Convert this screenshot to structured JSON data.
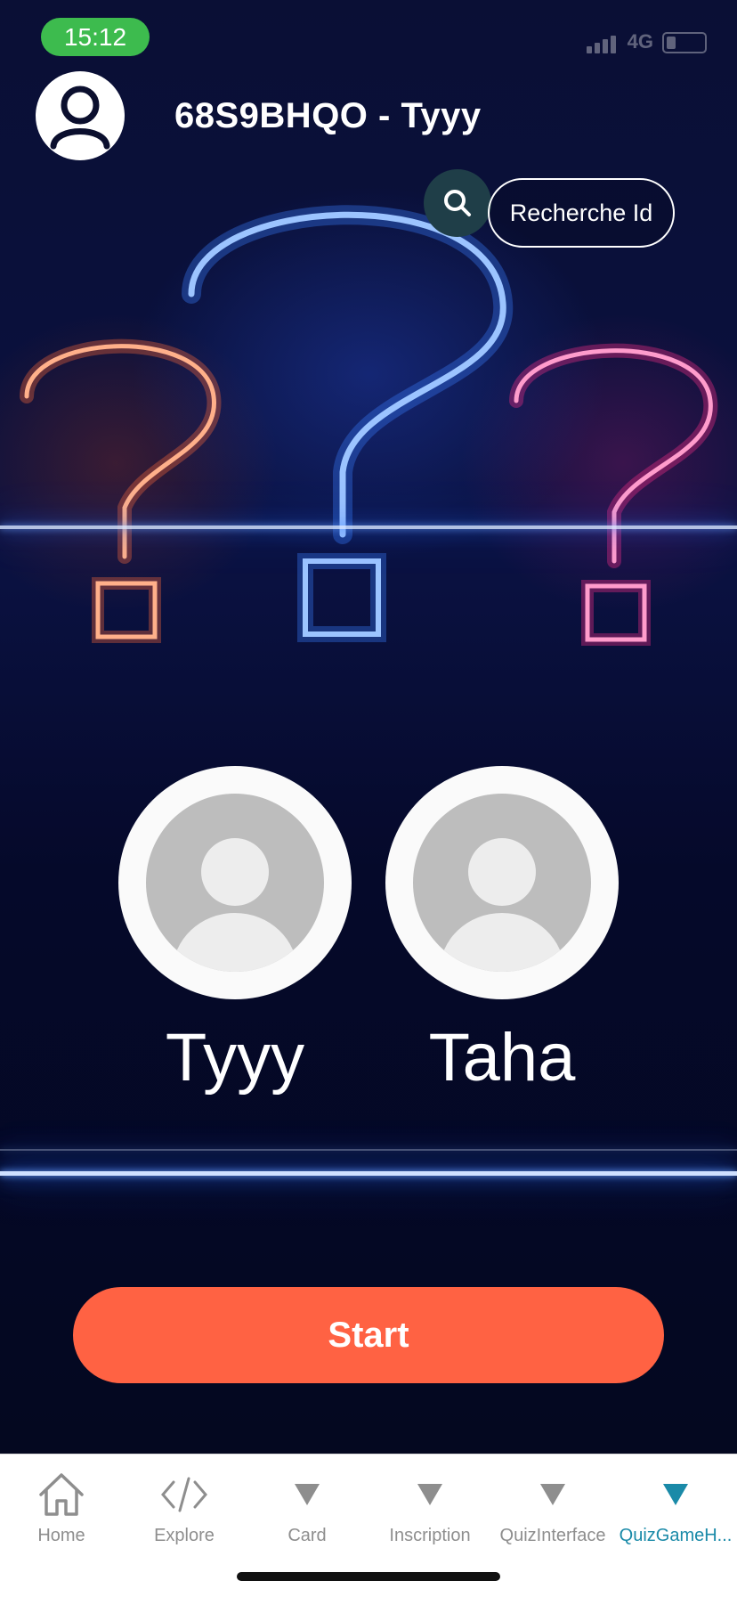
{
  "status_bar": {
    "time": "15:12",
    "network": "4G"
  },
  "header": {
    "title": "68S9BHQO - Tyyy"
  },
  "search": {
    "label": "Recherche Id"
  },
  "players": [
    {
      "name": "Tyyy"
    },
    {
      "name": "Taha"
    }
  ],
  "start_button": {
    "label": "Start"
  },
  "tabbar": {
    "tabs": [
      {
        "label": "Home",
        "icon": "home-icon",
        "active": false
      },
      {
        "label": "Explore",
        "icon": "code-icon",
        "active": false
      },
      {
        "label": "Card",
        "icon": "triangle-icon",
        "active": false
      },
      {
        "label": "Inscription",
        "icon": "triangle-icon",
        "active": false
      },
      {
        "label": "QuizInterface",
        "icon": "triangle-icon",
        "active": false
      },
      {
        "label": "QuizGameH...",
        "icon": "triangle-icon",
        "active": true
      }
    ]
  },
  "colors": {
    "accent_start": "#ff6243",
    "status_pill": "#3dbb4e",
    "active_tab": "#1a8aa8",
    "search_circle": "#1f3e48"
  }
}
